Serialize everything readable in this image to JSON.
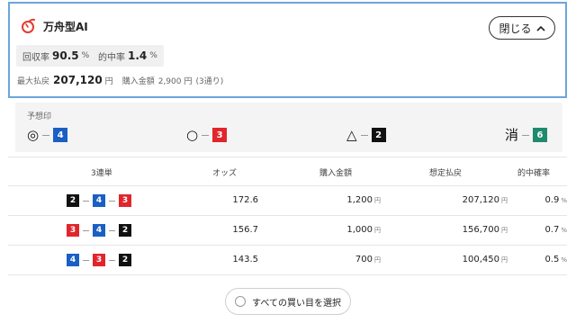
{
  "header": {
    "title": "万舟型AI",
    "close_label": "閉じる",
    "brand_color": "#e63b2e"
  },
  "stats": {
    "return_rate_label": "回収率",
    "return_rate_value": "90.5",
    "return_rate_unit": "%",
    "hit_rate_label": "的中率",
    "hit_rate_value": "1.4",
    "hit_rate_unit": "%"
  },
  "payout": {
    "max_label": "最大払戻",
    "max_value": "207,120",
    "max_unit": "円",
    "purchase_label": "購入金額",
    "purchase_value": "2,900",
    "purchase_unit": "円",
    "combos": "(3通り)"
  },
  "prediction": {
    "label": "予想印",
    "marks": [
      {
        "symbol": "◎",
        "boat": "4",
        "color": "#1a5fc4"
      },
      {
        "symbol": "○",
        "boat": "3",
        "color": "#e0262c"
      },
      {
        "symbol": "△",
        "boat": "2",
        "color": "#111111"
      },
      {
        "symbol": "消",
        "boat": "6",
        "color": "#1e8a6e"
      }
    ]
  },
  "table": {
    "headers": [
      "3連単",
      "オッズ",
      "購入金額",
      "想定払戻",
      "的中確率"
    ],
    "rows": [
      {
        "boats": [
          "2",
          "4",
          "3"
        ],
        "odds": "172.6",
        "amount": "1,200",
        "payout": "207,120",
        "prob": "0.9"
      },
      {
        "boats": [
          "3",
          "4",
          "2"
        ],
        "odds": "156.7",
        "amount": "1,000",
        "payout": "156,700",
        "prob": "0.7"
      },
      {
        "boats": [
          "4",
          "3",
          "2"
        ],
        "odds": "143.5",
        "amount": "700",
        "payout": "100,450",
        "prob": "0.5"
      }
    ],
    "yen": "円",
    "pct": "%"
  },
  "boat_colors": {
    "2": "#111111",
    "3": "#e0262c",
    "4": "#1a5fc4",
    "6": "#1e8a6e"
  },
  "select_all_label": "すべての買い目を選択"
}
